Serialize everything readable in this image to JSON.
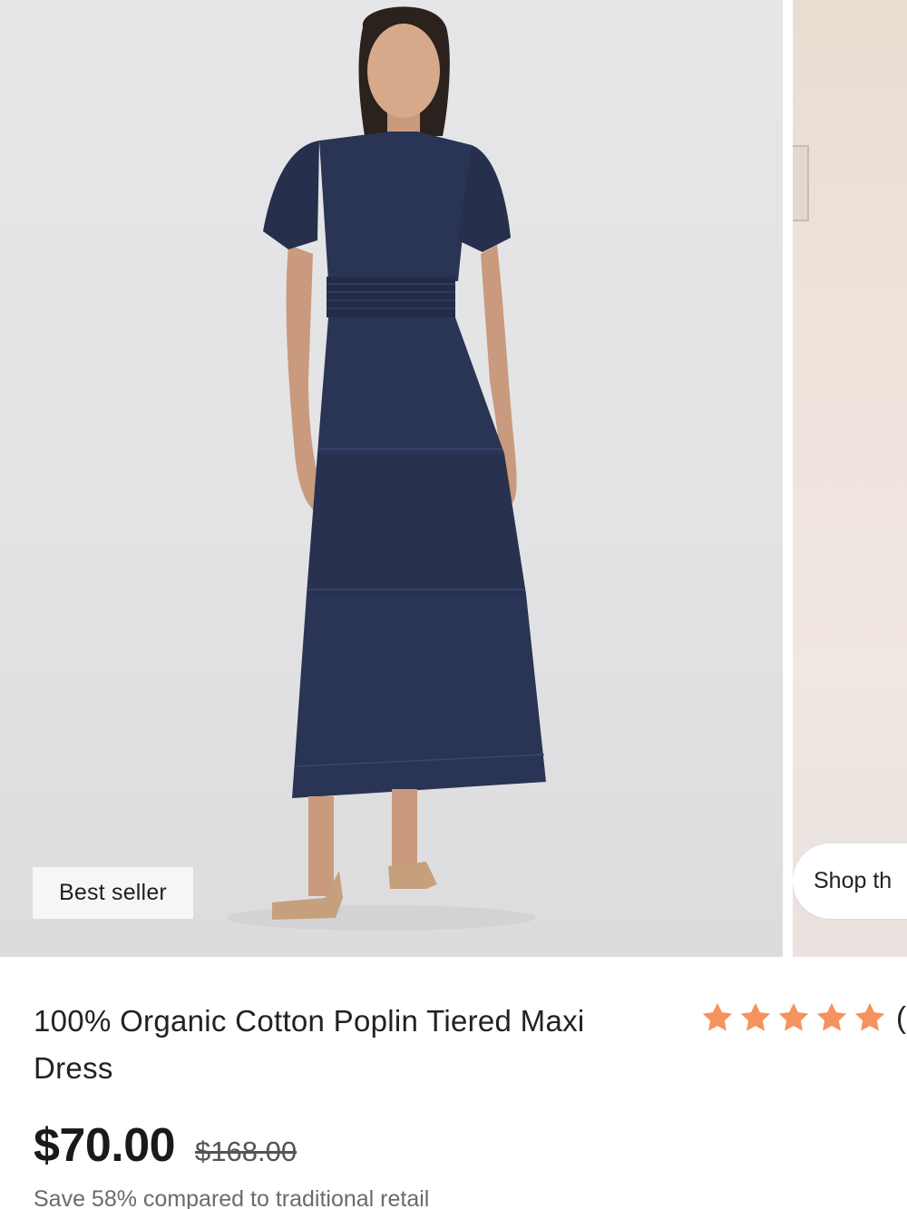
{
  "product_images": {
    "main_image_alt": "model-wearing-navy-dress",
    "badge_label": "Best seller",
    "next_slide_chip_label": "Shop th"
  },
  "product": {
    "title": "100% Organic Cotton Poplin Tiered Maxi Dress",
    "rating": {
      "stars": 5,
      "icon": "star-icon",
      "count_text": "("
    },
    "price": "$70.00",
    "original_price": "$168.00",
    "savings_note": "Save 58% compared to traditional retail"
  },
  "colors": {
    "star": "#f4935d",
    "dress": "#2a3454",
    "badge_bg": "#f6f6f6"
  }
}
